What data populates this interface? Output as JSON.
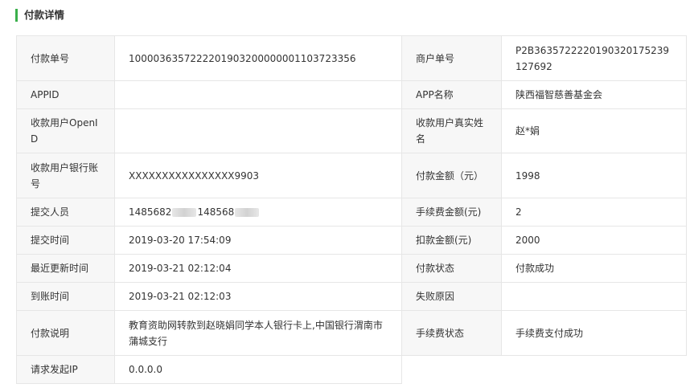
{
  "section_title": "付款详情",
  "rows": [
    {
      "l1": "付款单号",
      "v1": "1000036357222201903200000001103723356",
      "l2": "商户单号",
      "v2": "P2B36357222201903201752391​27692"
    },
    {
      "l1": "APPID",
      "v1": "",
      "l2": "APP名称",
      "v2": "陕西福智慈善基金会"
    },
    {
      "l1": "收款用户OpenID",
      "v1": "",
      "l2": "收款用户真实姓名",
      "v2": "赵*娟"
    },
    {
      "l1": "收款用户银行账号",
      "v1": "XXXXXXXXXXXXXXXX9903",
      "l2": "付款金额（元）",
      "v2": "1998"
    },
    {
      "l1": "提交人员",
      "v1a": "1485682",
      "v1b": "148568",
      "l2": "手续费金额(元)",
      "v2": "2"
    },
    {
      "l1": "提交时间",
      "v1": "2019-03-20 17:54:09",
      "l2": "扣款金额(元)",
      "v2": "2000"
    },
    {
      "l1": "最近更新时间",
      "v1": "2019-03-21 02:12:04",
      "l2": "付款状态",
      "v2": "付款成功"
    },
    {
      "l1": "到账时间",
      "v1": "2019-03-21 02:12:03",
      "l2": "失败原因",
      "v2": ""
    },
    {
      "l1": "付款说明",
      "v1": "教育资助网转款到赵晓娟同学本人银行卡上,中国银行渭南市蒲城支行",
      "l2": "手续费状态",
      "v2": "手续费支付成功"
    },
    {
      "l1": "请求发起IP",
      "v1": "0.0.0.0"
    }
  ]
}
